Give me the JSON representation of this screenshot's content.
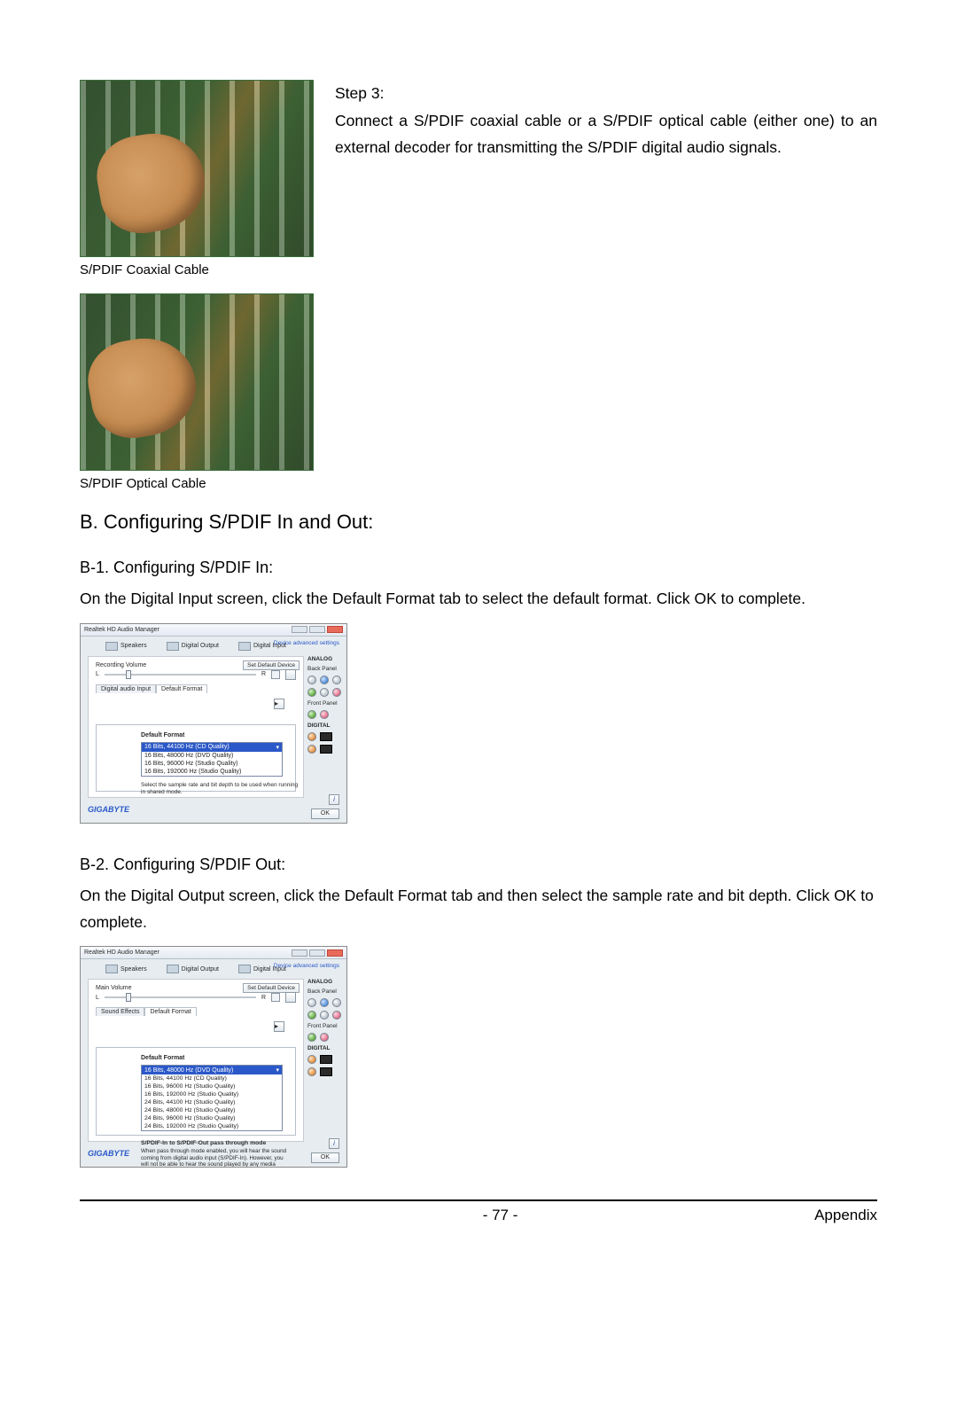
{
  "step": {
    "heading": "Step 3:",
    "body": "Connect a S/PDIF coaxial cable or a S/PDIF optical cable (either one) to an external decoder for transmitting the S/PDIF digital audio signals."
  },
  "captions": {
    "coax": "S/PDIF Coaxial Cable",
    "optical": "S/PDIF Optical Cable"
  },
  "sectionB": {
    "title": "B. Configuring S/PDIF In and Out:"
  },
  "b1": {
    "title": "B-1. Configuring S/PDIF In:",
    "body": "On the Digital Input screen, click the Default Format tab to select the default format. Click OK to complete."
  },
  "b2": {
    "title": "B-2. Configuring S/PDIF Out:",
    "body": "On the Digital Output screen, click the Default Format tab and then select the sample rate and bit depth. Click OK to complete."
  },
  "ss_in": {
    "window_title": "Realtek HD Audio Manager",
    "tabs": [
      "Speakers",
      "Digital Output",
      "Digital Input"
    ],
    "adv_link": "Device advanced settings",
    "volume_label": "Recording Volume",
    "set_default": "Set Default Device",
    "subtabs": [
      "Digital audio Input",
      "Default Format"
    ],
    "df_label": "Default Format",
    "dd_selected": "16 Bits, 44100 Hz (CD Quality)",
    "dd_options": [
      "16 Bits, 48000 Hz (DVD Quality)",
      "16 Bits, 96000 Hz (Studio Quality)",
      "16 Bits, 192000 Hz (Studio Quality)"
    ],
    "note": "Select the sample rate and bit depth to be used when running in shared mode.",
    "right": {
      "analog": "ANALOG",
      "back": "Back Panel",
      "front": "Front Panel",
      "digital": "DIGITAL"
    },
    "logo": "GIGABYTE",
    "ok": "OK",
    "info": "i"
  },
  "ss_out": {
    "window_title": "Realtek HD Audio Manager",
    "tabs": [
      "Speakers",
      "Digital Output",
      "Digital Input"
    ],
    "adv_link": "Device advanced settings",
    "volume_label": "Main Volume",
    "set_default": "Set Default Device",
    "subtabs": [
      "Sound Effects",
      "Default Format"
    ],
    "df_label": "Default Format",
    "dd_selected": "16 Bits, 48000 Hz (DVD Quality)",
    "dd_options": [
      "16 Bits, 44100 Hz (CD Quality)",
      "16 Bits, 96000 Hz (Studio Quality)",
      "16 Bits, 192000 Hz (Studio Quality)",
      "24 Bits, 44100 Hz (Studio Quality)",
      "24 Bits, 48000 Hz (Studio Quality)",
      "24 Bits, 96000 Hz (Studio Quality)",
      "24 Bits, 192000 Hz (Studio Quality)"
    ],
    "passthru_hdr": "S/PDIF-In to S/PDIF-Out pass through mode",
    "passthru_note": "When pass through mode enabled, you will hear the sound coming from digital audio input (S/PDIF-In). However, you will not be able to hear the sound played by any media players.",
    "right": {
      "analog": "ANALOG",
      "back": "Back Panel",
      "front": "Front Panel",
      "digital": "DIGITAL"
    },
    "logo": "GIGABYTE",
    "ok": "OK",
    "info": "i"
  },
  "footer": {
    "page": "- 77 -",
    "section": "Appendix"
  }
}
